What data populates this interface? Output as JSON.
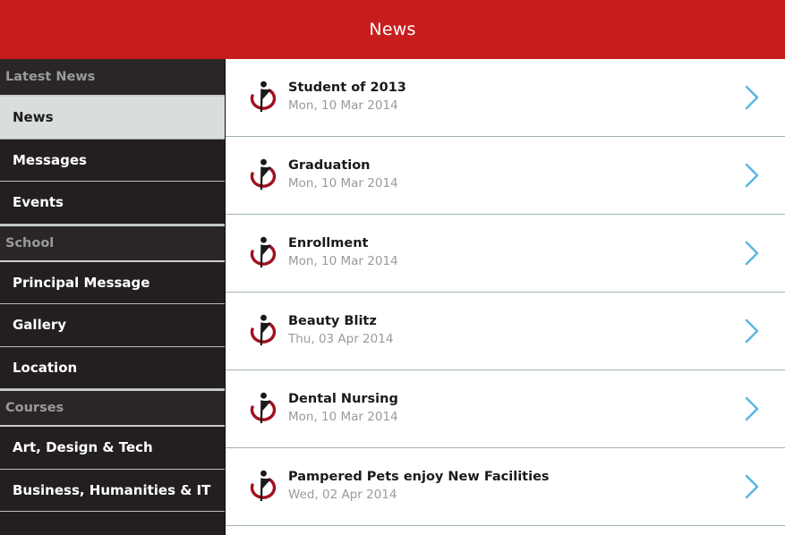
{
  "header": {
    "title": "News",
    "bg_color": "#c81d1d",
    "text_color": "#ffffff"
  },
  "sidebar": {
    "bg_color": "#231f20",
    "selected_bg_color": "#d9dddd",
    "groups": [
      {
        "header": "Latest News",
        "items": [
          {
            "label": "News",
            "selected": true
          },
          {
            "label": "Messages",
            "selected": false
          },
          {
            "label": "Events",
            "selected": false
          }
        ]
      },
      {
        "header": "School",
        "items": [
          {
            "label": "Principal Message",
            "selected": false
          },
          {
            "label": "Gallery",
            "selected": false
          },
          {
            "label": "Location",
            "selected": false
          }
        ]
      },
      {
        "header": "Courses",
        "items": [
          {
            "label": "Art, Design & Tech",
            "selected": false
          },
          {
            "label": "Business, Humanities & IT",
            "selected": false
          }
        ]
      }
    ]
  },
  "news_list": {
    "chevron_color": "#5cb6e6",
    "logo_figure_color": "#1a1a1a",
    "logo_swoosh_color": "#a01020",
    "items": [
      {
        "title": "Student of 2013",
        "date": "Mon, 10 Mar 2014",
        "icon": "school-logo-icon",
        "chevron": "chevron-right-icon"
      },
      {
        "title": "Graduation",
        "date": "Mon, 10 Mar 2014",
        "icon": "school-logo-icon",
        "chevron": "chevron-right-icon"
      },
      {
        "title": "Enrollment",
        "date": "Mon, 10 Mar 2014",
        "icon": "school-logo-icon",
        "chevron": "chevron-right-icon"
      },
      {
        "title": "Beauty Blitz",
        "date": "Thu, 03 Apr 2014",
        "icon": "school-logo-icon",
        "chevron": "chevron-right-icon"
      },
      {
        "title": "Dental Nursing",
        "date": "Mon, 10 Mar 2014",
        "icon": "school-logo-icon",
        "chevron": "chevron-right-icon"
      },
      {
        "title": "Pampered Pets enjoy New Facilities",
        "date": "Wed, 02 Apr 2014",
        "icon": "school-logo-icon",
        "chevron": "chevron-right-icon"
      }
    ]
  }
}
